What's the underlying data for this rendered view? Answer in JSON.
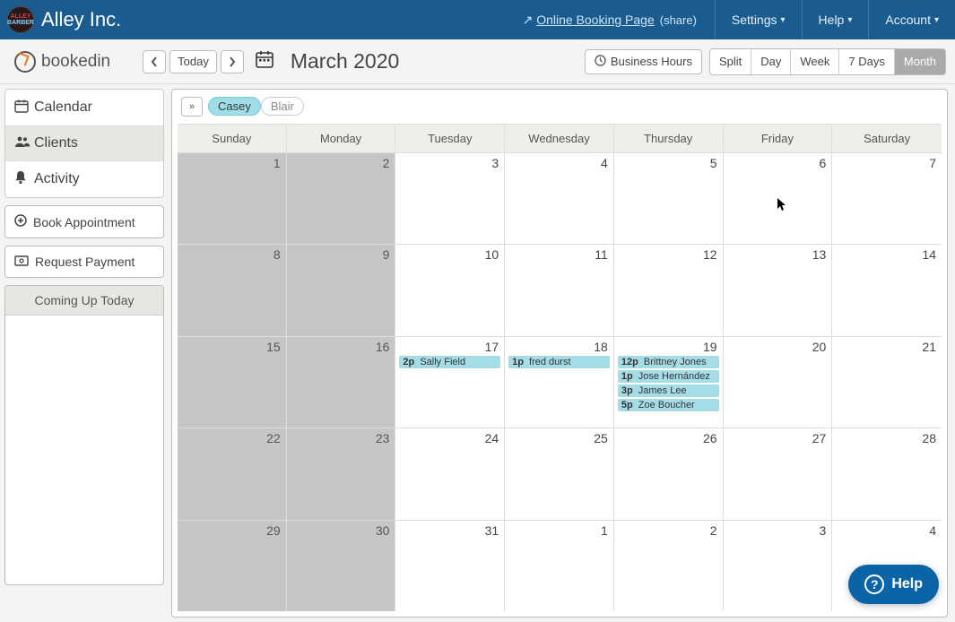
{
  "header": {
    "app_title": "Alley Inc.",
    "booking_link": "Online Booking Page",
    "share_label": "(share)",
    "menus": {
      "settings": "Settings",
      "help": "Help",
      "account": "Account"
    }
  },
  "subheader": {
    "brand": "bookedin",
    "today_btn": "Today",
    "month_title": "March 2020",
    "hours_btn": "Business Hours",
    "views": {
      "split": "Split",
      "day": "Day",
      "week": "Week",
      "seven": "7 Days",
      "month": "Month"
    },
    "active_view": "month"
  },
  "sidebar": {
    "items": [
      {
        "label": "Calendar",
        "icon": "calendar"
      },
      {
        "label": "Clients",
        "icon": "clients"
      },
      {
        "label": "Activity",
        "icon": "activity"
      }
    ],
    "active_index": 1,
    "book_btn": "Book Appointment",
    "payment_btn": "Request Payment",
    "coming_up": "Coming Up Today"
  },
  "staff": {
    "chips": [
      {
        "name": "Casey",
        "active": true
      },
      {
        "name": "Blair",
        "active": false
      }
    ]
  },
  "calendar": {
    "dow": [
      "Sunday",
      "Monday",
      "Tuesday",
      "Wednesday",
      "Thursday",
      "Friday",
      "Saturday"
    ],
    "weeks": [
      [
        {
          "n": "1",
          "grey": true
        },
        {
          "n": "2",
          "grey": true
        },
        {
          "n": "3"
        },
        {
          "n": "4"
        },
        {
          "n": "5"
        },
        {
          "n": "6"
        },
        {
          "n": "7"
        }
      ],
      [
        {
          "n": "8",
          "grey": true
        },
        {
          "n": "9",
          "grey": true
        },
        {
          "n": "10"
        },
        {
          "n": "11"
        },
        {
          "n": "12"
        },
        {
          "n": "13"
        },
        {
          "n": "14"
        }
      ],
      [
        {
          "n": "15",
          "grey": true
        },
        {
          "n": "16",
          "grey": true
        },
        {
          "n": "17",
          "appts": [
            {
              "t": "2p",
              "name": "Sally Field"
            }
          ]
        },
        {
          "n": "18",
          "appts": [
            {
              "t": "1p",
              "name": "fred durst"
            }
          ]
        },
        {
          "n": "19",
          "appts": [
            {
              "t": "12p",
              "name": "Brittney Jones"
            },
            {
              "t": "1p",
              "name": "Jose Hernández"
            },
            {
              "t": "3p",
              "name": "James Lee"
            },
            {
              "t": "5p",
              "name": "Zoe Boucher"
            }
          ]
        },
        {
          "n": "20"
        },
        {
          "n": "21"
        }
      ],
      [
        {
          "n": "22",
          "grey": true
        },
        {
          "n": "23",
          "grey": true
        },
        {
          "n": "24"
        },
        {
          "n": "25"
        },
        {
          "n": "26"
        },
        {
          "n": "27"
        },
        {
          "n": "28"
        }
      ],
      [
        {
          "n": "29",
          "grey": true
        },
        {
          "n": "30",
          "grey": true
        },
        {
          "n": "31"
        },
        {
          "n": "1"
        },
        {
          "n": "2"
        },
        {
          "n": "3"
        },
        {
          "n": "4"
        }
      ]
    ]
  },
  "help_fab": "Help"
}
